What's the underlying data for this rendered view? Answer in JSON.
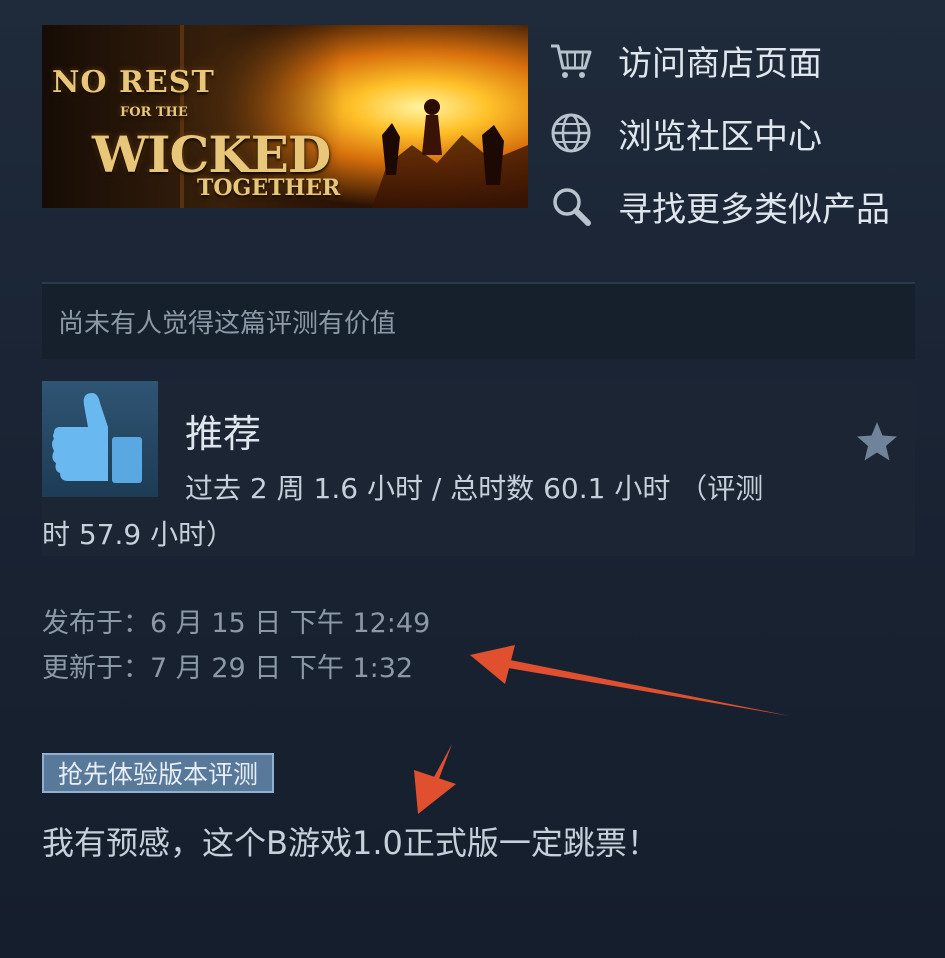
{
  "game": {
    "banner_text": [
      "NO REST",
      "FOR THE",
      "WICKED",
      "TOGETHER"
    ]
  },
  "links": [
    {
      "icon": "cart-icon",
      "label": "访问商店页面"
    },
    {
      "icon": "globe-icon",
      "label": "浏览社区中心"
    },
    {
      "icon": "search-icon",
      "label": "寻找更多类似产品"
    }
  ],
  "helpful": {
    "text": "尚未有人觉得这篇评测有价值"
  },
  "review": {
    "verdict": "推荐",
    "hours_line1": "过去 2 周 1.6 小时 / 总时数 60.1 小时 （评测",
    "hours_line2": "时 57.9 小时）",
    "posted": "发布于：6 月 15 日 下午 12:49",
    "updated": "更新于：7 月 29 日 下午 1:32",
    "badge": "抢先体验版本评测",
    "text": "我有预感，这个B游戏1.0正式版一定跳票！"
  },
  "colors": {
    "background": "#1a2434",
    "accent_thumb": "#4fa3e0",
    "annotation_arrow": "#e0502f",
    "badge_bg": "#58799a"
  }
}
